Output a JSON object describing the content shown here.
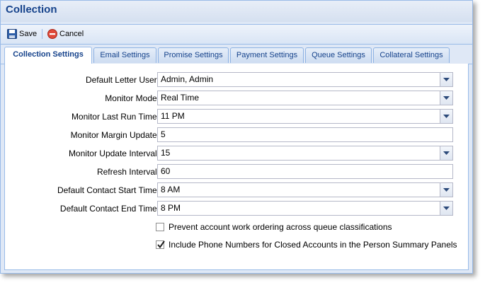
{
  "window": {
    "title": "Collection"
  },
  "toolbar": {
    "save_label": "Save",
    "cancel_label": "Cancel"
  },
  "tabs": [
    {
      "label": "Collection Settings",
      "active": true
    },
    {
      "label": "Email Settings"
    },
    {
      "label": "Promise Settings"
    },
    {
      "label": "Payment Settings"
    },
    {
      "label": "Queue Settings"
    },
    {
      "label": "Collateral Settings"
    }
  ],
  "form": {
    "default_letter_user": {
      "label": "Default Letter User:",
      "value": "Admin, Admin"
    },
    "monitor_mode": {
      "label": "Monitor Mode:",
      "value": "Real Time"
    },
    "monitor_last_run_time": {
      "label": "Monitor Last Run Time:",
      "value": "11 PM"
    },
    "monitor_margin_update": {
      "label": "Monitor Margin Update:",
      "value": "5"
    },
    "monitor_update_interval": {
      "label": "Monitor Update Interval:",
      "value": "15"
    },
    "refresh_interval": {
      "label": "Refresh Interval:",
      "value": "60"
    },
    "default_contact_start_time": {
      "label": "Default Contact Start Time:",
      "value": "8 AM"
    },
    "default_contact_end_time": {
      "label": "Default Contact End Time:",
      "value": "8 PM"
    }
  },
  "checkboxes": {
    "prevent_ordering": {
      "label": "Prevent account work ordering across queue classifications",
      "checked": false
    },
    "include_phone_numbers": {
      "label": "Include Phone Numbers for Closed Accounts in the Person Summary Panels",
      "checked": true
    }
  },
  "colors": {
    "accent": "#15428b",
    "border": "#99bbe8",
    "panel_bg": "#dfe8f6"
  }
}
